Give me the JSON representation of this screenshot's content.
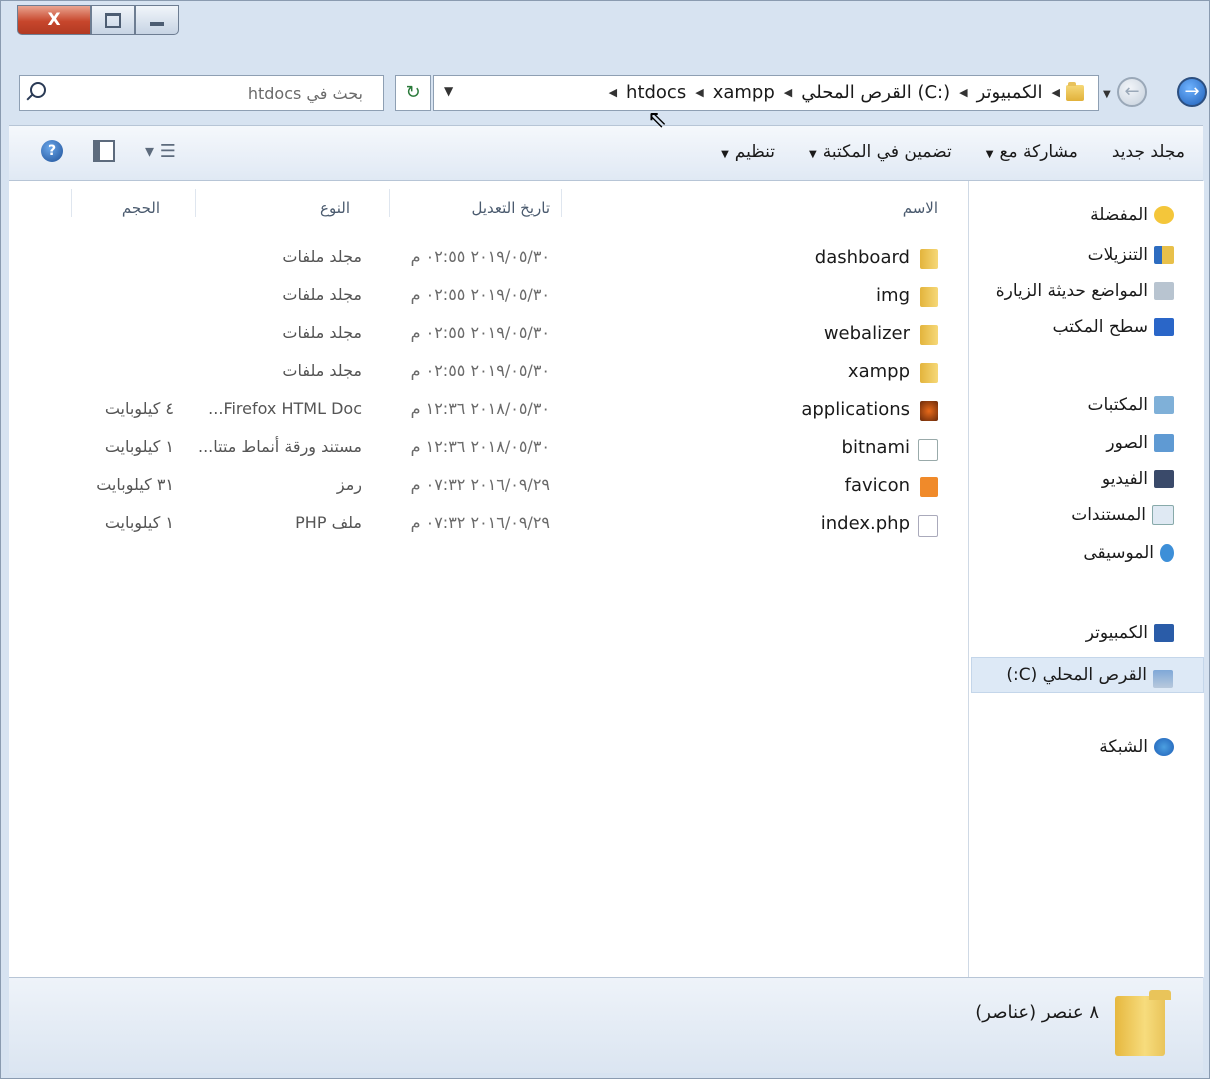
{
  "window": {
    "close_glyph": "X"
  },
  "address": {
    "crumbs": [
      "الكمبيوتر",
      "القرص المحلي (C:)",
      "xampp",
      "htdocs"
    ],
    "search_placeholder": "بحث في htdocs"
  },
  "toolbar": {
    "organize": "تنظيم",
    "include_in_library": "تضمين في المكتبة",
    "share_with": "مشاركة مع",
    "new_folder": "مجلد جديد"
  },
  "nav": {
    "favorites": "المفضلة",
    "downloads": "التنزيلات",
    "recent_places": "المواضع حديثة الزيارة",
    "desktop": "سطح المكتب",
    "libraries": "المكتبات",
    "pictures": "الصور",
    "videos": "الفيديو",
    "documents": "المستندات",
    "music": "الموسيقى",
    "computer": "الكمبيوتر",
    "local_disk": "القرص المحلي (C:)",
    "network": "الشبكة"
  },
  "columns": {
    "name": "الاسم",
    "date": "تاريخ التعديل",
    "type": "النوع",
    "size": "الحجم"
  },
  "files": [
    {
      "name": "dashboard",
      "date": "٢٠١٩/٠٥/٣٠ ٠٢:٥٥ م",
      "type": "مجلد ملفات",
      "size": "",
      "icon": "folder-icon"
    },
    {
      "name": "img",
      "date": "٢٠١٩/٠٥/٣٠ ٠٢:٥٥ م",
      "type": "مجلد ملفات",
      "size": "",
      "icon": "folder-icon"
    },
    {
      "name": "webalizer",
      "date": "٢٠١٩/٠٥/٣٠ ٠٢:٥٥ م",
      "type": "مجلد ملفات",
      "size": "",
      "icon": "folder-icon"
    },
    {
      "name": "xampp",
      "date": "٢٠١٩/٠٥/٣٠ ٠٢:٥٥ م",
      "type": "مجلد ملفات",
      "size": "",
      "icon": "folder-icon"
    },
    {
      "name": "applications",
      "date": "٢٠١٨/٠٥/٣٠ ١٢:٣٦ م",
      "type": "Firefox HTML Doc...",
      "size": "٤ كيلوبايت",
      "icon": "firefox-html-icon"
    },
    {
      "name": "bitnami",
      "date": "٢٠١٨/٠٥/٣٠ ١٢:٣٦ م",
      "type": "مستند ورقة أنماط متتا...",
      "size": "١ كيلوبايت",
      "icon": "css-file-icon"
    },
    {
      "name": "favicon",
      "date": "٢٠١٦/٠٩/٢٩ ٠٧:٣٢ م",
      "type": "رمز",
      "size": "٣١ كيلوبايت",
      "icon": "ico-file-icon"
    },
    {
      "name": "index.php",
      "date": "٢٠١٦/٠٩/٢٩ ٠٧:٣٢ م",
      "type": "ملف PHP",
      "size": "١ كيلوبايت",
      "icon": "php-file-icon"
    }
  ],
  "status": {
    "count_text": "٨ عنصر (عناصر)"
  },
  "colors": {
    "folder": "#e8c04a",
    "selection": "#dde9f6",
    "accent": "#1f5fb8"
  }
}
